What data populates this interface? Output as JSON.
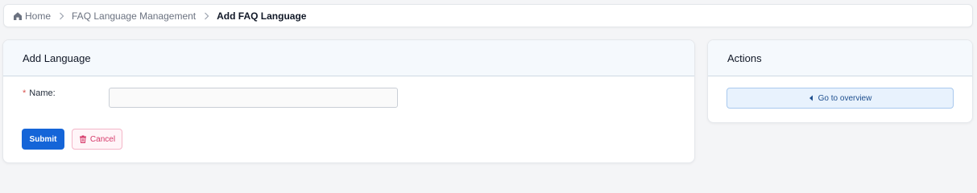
{
  "breadcrumb": {
    "items": [
      {
        "label": "Home"
      },
      {
        "label": "FAQ Language Management"
      },
      {
        "label": "Add FAQ Language"
      }
    ]
  },
  "main_card": {
    "title": "Add Language",
    "form": {
      "required_marker": "*",
      "name_label": "Name:",
      "name_value": "",
      "name_placeholder": ""
    },
    "buttons": {
      "submit_label": "Submit",
      "cancel_label": "Cancel"
    }
  },
  "actions_card": {
    "title": "Actions",
    "overview_label": "Go to overview"
  },
  "icons": {
    "home": "home-icon",
    "separator": "chevron-right-icon",
    "cancel": "trash-icon",
    "overview": "caret-left-icon"
  },
  "colors": {
    "primary": "#1565d8",
    "danger": "#d63a6a",
    "required": "#d9534f",
    "header_bg": "#f5f9fd"
  }
}
